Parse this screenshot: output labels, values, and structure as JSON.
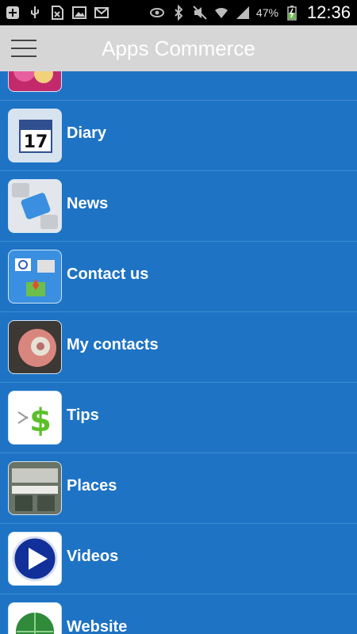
{
  "status_bar": {
    "battery": "47%",
    "time": "12:36"
  },
  "app_bar": {
    "title": "Apps Commerce",
    "menu_icon": "hamburger-menu-icon"
  },
  "menu": {
    "items": [
      {
        "label": "",
        "icon": "partial-item-icon"
      },
      {
        "label": "Diary",
        "icon": "calendar-icon"
      },
      {
        "label": "News",
        "icon": "news-key-icon"
      },
      {
        "label": "Contact us",
        "icon": "contact-icon"
      },
      {
        "label": "My contacts",
        "icon": "rotary-phone-icon"
      },
      {
        "label": "Tips",
        "icon": "dollar-scissors-icon"
      },
      {
        "label": "Places",
        "icon": "storefront-icon"
      },
      {
        "label": "Videos",
        "icon": "play-icon"
      },
      {
        "label": "Website",
        "icon": "globe-icon"
      }
    ]
  },
  "colors": {
    "list_background": "#1e73c4",
    "app_bar_background": "#d6d6d6",
    "status_bar_background": "#000000"
  }
}
